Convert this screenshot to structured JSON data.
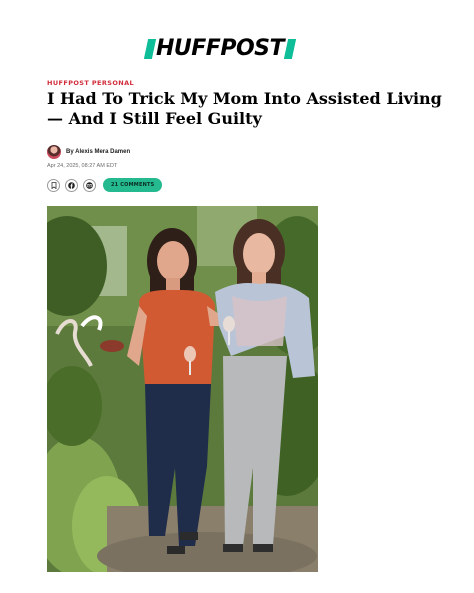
{
  "brand": {
    "logo_text": "HUFFPOST",
    "accent_color": "#0dbe98"
  },
  "article": {
    "kicker": "HUFFPOST PERSONAL",
    "kicker_color": "#d12d3a",
    "headline": "I Had To Trick My Mom Into Assisted Living — And I Still Feel Guilty",
    "author": "By Alexis Mera Damen",
    "timestamp": "Apr 24, 2025, 08:27 AM EDT"
  },
  "share": {
    "icons": [
      "bookmark-icon",
      "facebook-icon",
      "email-icon"
    ],
    "comments_label": "21 COMMENTS",
    "comments_color": "#24b98f"
  }
}
